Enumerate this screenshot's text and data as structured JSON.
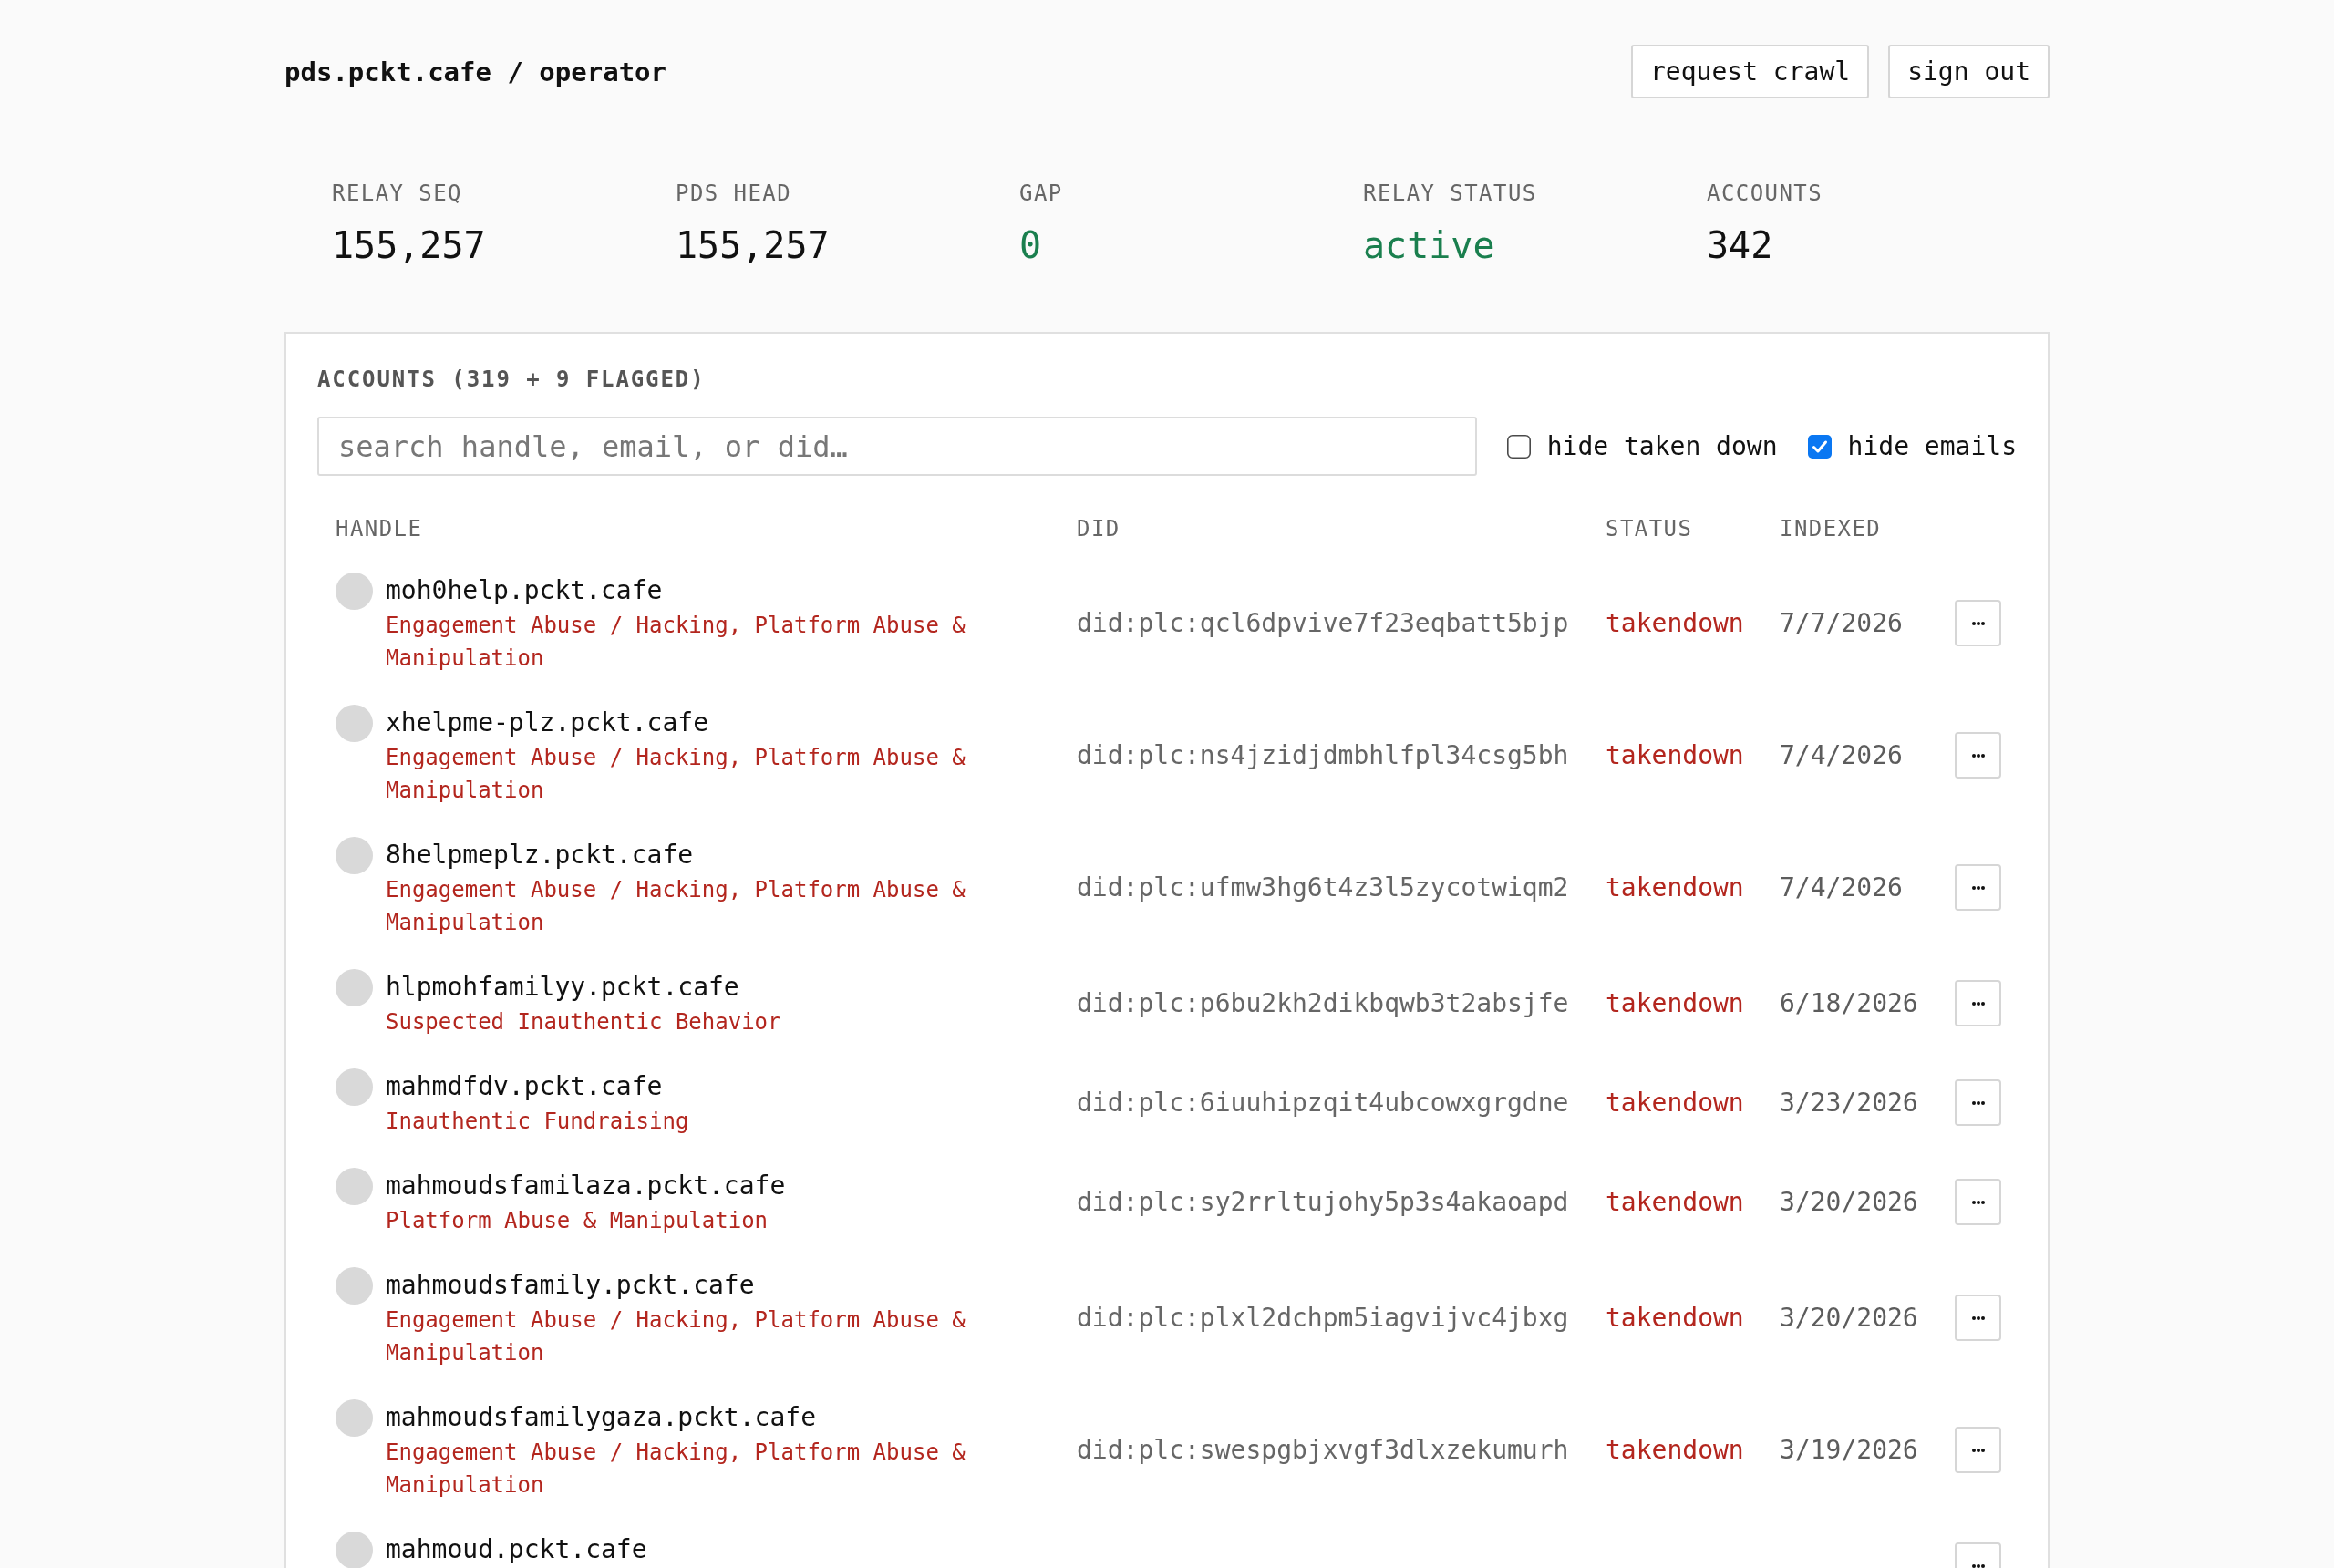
{
  "header": {
    "title": "pds.pckt.cafe / operator",
    "buttons": [
      "request crawl",
      "sign out"
    ]
  },
  "stats": [
    {
      "label": "RELAY SEQ",
      "value": "155,257",
      "color": "#111111"
    },
    {
      "label": "PDS HEAD",
      "value": "155,257",
      "color": "#111111"
    },
    {
      "label": "GAP",
      "value": "0",
      "color": "#1a7f4e"
    },
    {
      "label": "RELAY STATUS",
      "value": "active",
      "color": "#1a7f4e"
    },
    {
      "label": "ACCOUNTS",
      "value": "342",
      "color": "#111111"
    }
  ],
  "accounts_panel": {
    "title": "ACCOUNTS (319 + 9 FLAGGED)",
    "search": {
      "placeholder": "search handle, email, or did…"
    },
    "filters": [
      {
        "label": "hide taken down",
        "checked": false
      },
      {
        "label": "hide emails",
        "checked": true
      }
    ],
    "table": {
      "columns": [
        "HANDLE",
        "DID",
        "STATUS",
        "INDEXED"
      ],
      "rows": [
        {
          "handle": "moh0help.pckt.cafe",
          "flags": "Engagement Abuse / Hacking, Platform Abuse & Manipulation",
          "did": "did:plc:qcl6dpvive7f23eqbatt5bjp",
          "status": "takendown",
          "indexed": "7/7/2026"
        },
        {
          "handle": "xhelpme-plz.pckt.cafe",
          "flags": "Engagement Abuse / Hacking, Platform Abuse & Manipulation",
          "did": "did:plc:ns4jzidjdmbhlfpl34csg5bh",
          "status": "takendown",
          "indexed": "7/4/2026"
        },
        {
          "handle": "8helpmeplz.pckt.cafe",
          "flags": "Engagement Abuse / Hacking, Platform Abuse & Manipulation",
          "did": "did:plc:ufmw3hg6t4z3l5zycotwiqm2",
          "status": "takendown",
          "indexed": "7/4/2026"
        },
        {
          "handle": "hlpmohfamilyy.pckt.cafe",
          "flags": "Suspected Inauthentic Behavior",
          "did": "did:plc:p6bu2kh2dikbqwb3t2absjfe",
          "status": "takendown",
          "indexed": "6/18/2026"
        },
        {
          "handle": "mahmdfdv.pckt.cafe",
          "flags": "Inauthentic Fundraising",
          "did": "did:plc:6iuuhipzqit4ubcowxgrgdne",
          "status": "takendown",
          "indexed": "3/23/2026"
        },
        {
          "handle": "mahmoudsfamilaza.pckt.cafe",
          "flags": "Platform Abuse & Manipulation",
          "did": "did:plc:sy2rrltujohy5p3s4akaoapd",
          "status": "takendown",
          "indexed": "3/20/2026"
        },
        {
          "handle": "mahmoudsfamily.pckt.cafe",
          "flags": "Engagement Abuse / Hacking, Platform Abuse & Manipulation",
          "did": "did:plc:plxl2dchpm5iagvijvc4jbxg",
          "status": "takendown",
          "indexed": "3/20/2026"
        },
        {
          "handle": "mahmoudsfamilygaza.pckt.cafe",
          "flags": "Engagement Abuse / Hacking, Platform Abuse & Manipulation",
          "did": "did:plc:swespgbjxvgf3dlxzekumurh",
          "status": "takendown",
          "indexed": "3/19/2026"
        },
        {
          "handle": "mahmoud.pckt.cafe"
        }
      ]
    }
  }
}
